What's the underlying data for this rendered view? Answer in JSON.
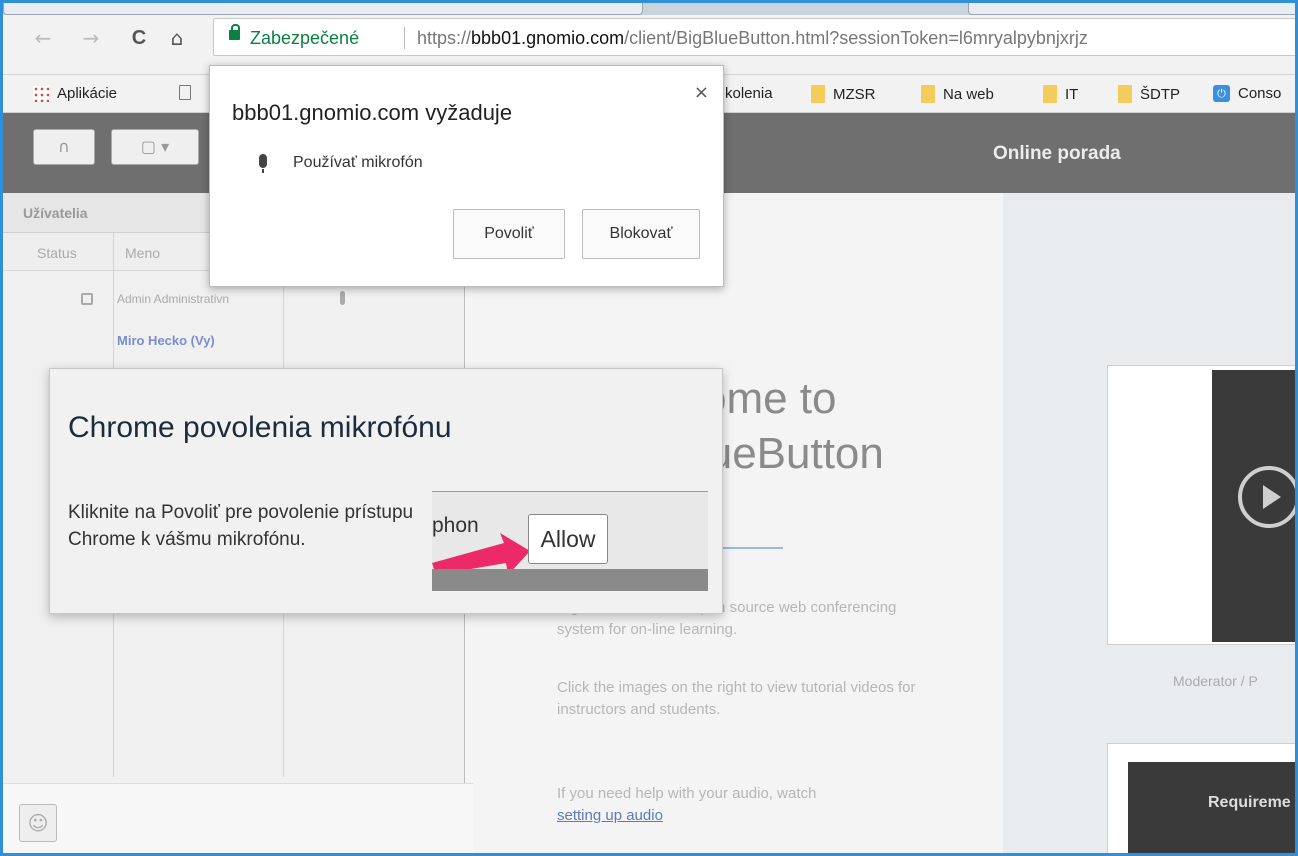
{
  "browser": {
    "secure_label": "Zabezpečené",
    "url_scheme": "https://",
    "url_host": "bbb01.gnomio.com",
    "url_path": "/client/BigBlueButton.html?sessionToken=l6mryalpybnjxrjz",
    "nav": {
      "back": "←",
      "forward": "→",
      "reload": "C",
      "home": "⌂"
    },
    "bookmarks": [
      {
        "label": "Aplikácie",
        "icon": "apps-icon"
      },
      {
        "label": "",
        "icon": "page-icon"
      },
      {
        "label": "kolenia",
        "icon": "folder-icon"
      },
      {
        "label": "MZSR",
        "icon": "folder-icon"
      },
      {
        "label": "Na web",
        "icon": "folder-icon"
      },
      {
        "label": "IT",
        "icon": "folder-icon"
      },
      {
        "label": "ŠDTP",
        "icon": "folder-icon"
      },
      {
        "label": "Conso",
        "icon": "power-icon"
      }
    ]
  },
  "permission_popup": {
    "title": "bbb01.gnomio.com vyžaduje",
    "permission": "Používať mikrofón",
    "allow_label": "Povoliť",
    "block_label": "Blokovať",
    "close": "×"
  },
  "app": {
    "title": "Online porada",
    "users_header": "Užívatelia",
    "col_status": "Status",
    "col_name": "Meno",
    "users": [
      {
        "name": "Admin Administrativn"
      },
      {
        "name": "Miro Hecko (Vy)"
      }
    ]
  },
  "welcome": {
    "title_line1": "Welcome to",
    "title_line2": "BigBlueButton",
    "p1": "BigBlueButton is an open source web conferencing system for on-line learning.",
    "p2": "Click the images on the right to view tutorial videos for instructors and students.",
    "p3": "If you need help with your audio, watch",
    "link": "setting up audio",
    "thumb_caption": "Moderator / P",
    "thumb2_label": "Requireme"
  },
  "instruction": {
    "title": "Chrome povolenia mikrofónu",
    "body": "Kliknite na Povoliť pre povolenie prístupu Chrome k vášmu mikrofónu.",
    "partial_text": "phon",
    "allow_label": "Allow"
  },
  "colors": {
    "frame_border": "#2f8fd8",
    "secure_green": "#0b8043",
    "arrow_pink": "#ec2a6a"
  }
}
